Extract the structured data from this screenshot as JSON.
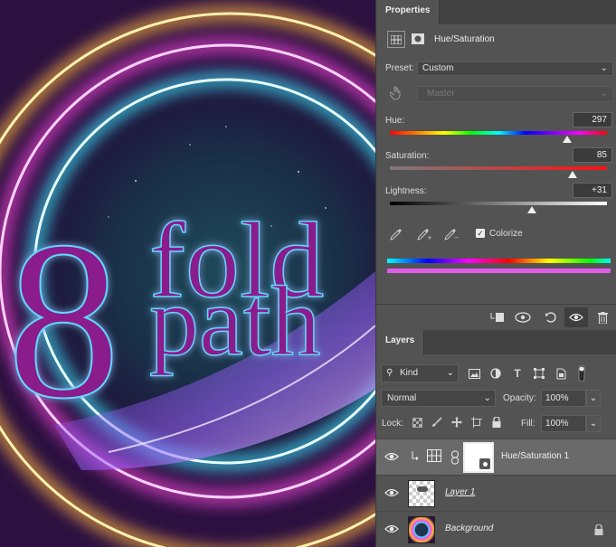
{
  "properties": {
    "tab_label": "Properties",
    "adjustment_title": "Hue/Saturation",
    "preset_label": "Preset:",
    "preset_value": "Custom",
    "channel_value": "Master",
    "hue": {
      "label": "Hue:",
      "value": "297",
      "fraction": 0.815
    },
    "saturation": {
      "label": "Saturation:",
      "value": "85",
      "fraction": 0.843
    },
    "lightness": {
      "label": "Lightness:",
      "value": "+31",
      "fraction": 0.655
    },
    "colorize_label": "Colorize",
    "colorize_checked": true
  },
  "layers": {
    "tab_label": "Layers",
    "filter_kind": "Kind",
    "blend_mode": "Normal",
    "opacity_label": "Opacity:",
    "opacity_value": "100%",
    "lock_label": "Lock:",
    "fill_label": "Fill:",
    "fill_value": "100%",
    "items": [
      {
        "name": "Hue/Saturation 1"
      },
      {
        "name": "Layer 1"
      },
      {
        "name": "Background"
      }
    ]
  },
  "artwork": {
    "numeral": "8",
    "word_top": "fold",
    "word_bottom": "path",
    "text_color": "#8a1a8c",
    "glow_color": "#5fd8ff"
  }
}
